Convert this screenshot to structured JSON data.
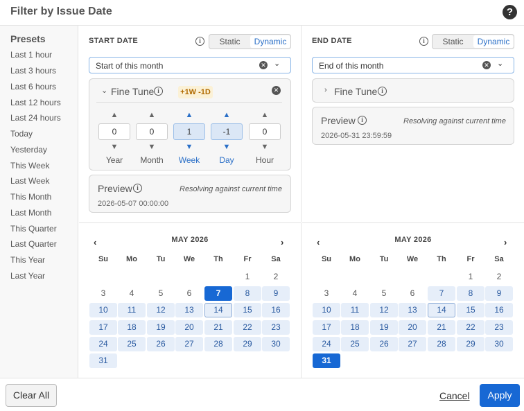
{
  "title": "Filter by Issue Date",
  "help_icon": "?",
  "presets": {
    "title": "Presets",
    "items": [
      "Last 1 hour",
      "Last 3 hours",
      "Last 6 hours",
      "Last 12 hours",
      "Last 24 hours",
      "Today",
      "Yesterday",
      "This Week",
      "Last Week",
      "This Month",
      "Last Month",
      "This Quarter",
      "Last Quarter",
      "This Year",
      "Last Year"
    ]
  },
  "start": {
    "title": "START DATE",
    "toggle": {
      "static": "Static",
      "dynamic": "Dynamic",
      "selected": "Dynamic"
    },
    "select_value": "Start of this month",
    "fine_tune": {
      "title": "Fine Tune",
      "badge": "+1W -1D",
      "steppers": [
        {
          "label": "Year",
          "value": "0"
        },
        {
          "label": "Month",
          "value": "0"
        },
        {
          "label": "Week",
          "value": "1"
        },
        {
          "label": "Day",
          "value": "-1"
        },
        {
          "label": "Hour",
          "value": "0"
        }
      ]
    },
    "preview": {
      "title": "Preview",
      "note": "Resolving against current time",
      "date": "2026-05-07 00:00:00"
    },
    "calendar": {
      "month": "MAY 2026"
    }
  },
  "end": {
    "title": "END DATE",
    "toggle": {
      "static": "Static",
      "dynamic": "Dynamic",
      "selected": "Dynamic"
    },
    "select_value": "End of this month",
    "fine_tune": {
      "title": "Fine Tune"
    },
    "preview": {
      "title": "Preview",
      "note": "Resolving against current time",
      "date": "2026-05-31 23:59:59"
    },
    "calendar": {
      "month": "MAY 2026"
    }
  },
  "calendar": {
    "prev": "‹",
    "next": "›",
    "weekdays": [
      "Su",
      "Mo",
      "Tu",
      "We",
      "Th",
      "Fr",
      "Sa"
    ],
    "weeks": [
      [
        "",
        "",
        "",
        "",
        "",
        "1",
        "2"
      ],
      [
        "3",
        "4",
        "5",
        "6",
        "7",
        "8",
        "9"
      ],
      [
        "10",
        "11",
        "12",
        "13",
        "14",
        "15",
        "16"
      ],
      [
        "17",
        "18",
        "19",
        "20",
        "21",
        "22",
        "23"
      ],
      [
        "24",
        "25",
        "26",
        "27",
        "28",
        "29",
        "30"
      ],
      [
        "31",
        "",
        "",
        "",
        "",
        "",
        ""
      ]
    ],
    "today": "14"
  },
  "footer": {
    "clear": "Clear All",
    "cancel": "Cancel",
    "apply": "Apply"
  },
  "colors": {
    "accent": "#1768d4",
    "range": "#e6eef9",
    "badge_bg": "#fbf1d6",
    "badge_text": "#b06a00"
  }
}
